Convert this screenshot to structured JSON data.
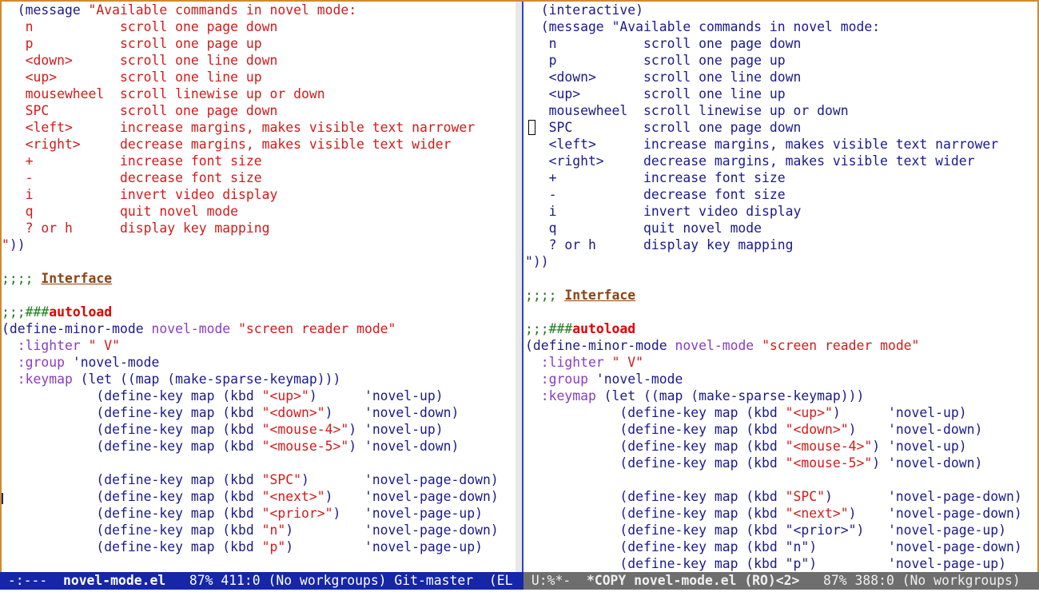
{
  "left_window": {
    "lines": [
      [
        {
          "t": "  (",
          "c": "t-kw"
        },
        {
          "t": "message",
          "c": "t-kw"
        },
        {
          "t": " \"Available commands in novel mode:",
          "c": "t-str"
        }
      ],
      [
        {
          "t": "   n           scroll one page down",
          "c": "t-str"
        }
      ],
      [
        {
          "t": "   p           scroll one page up",
          "c": "t-str"
        }
      ],
      [
        {
          "t": "   <down>      scroll one line down",
          "c": "t-str"
        }
      ],
      [
        {
          "t": "   <up>        scroll one line up",
          "c": "t-str"
        }
      ],
      [
        {
          "t": "   mousewheel  scroll linewise up or down",
          "c": "t-str"
        }
      ],
      [
        {
          "t": "   SPC         scroll one page down",
          "c": "t-str"
        }
      ],
      [
        {
          "t": "   <left>      increase margins, makes visible text narrower",
          "c": "t-str"
        }
      ],
      [
        {
          "t": "   <right>     decrease margins, makes visible text wider",
          "c": "t-str"
        }
      ],
      [
        {
          "t": "   +           increase font size",
          "c": "t-str"
        }
      ],
      [
        {
          "t": "   -           decrease font size",
          "c": "t-str"
        }
      ],
      [
        {
          "t": "   i           invert video display",
          "c": "t-str"
        }
      ],
      [
        {
          "t": "   q           quit novel mode",
          "c": "t-str"
        }
      ],
      [
        {
          "t": "   ? or h      display key mapping",
          "c": "t-str"
        }
      ],
      [
        {
          "t": "\"",
          "c": "t-str"
        },
        {
          "t": "))",
          "c": "t-kw"
        }
      ],
      [
        {
          "t": "",
          "c": "t-kw"
        }
      ],
      [
        {
          "t": ";;;; ",
          "c": "t-com"
        },
        {
          "t": "Interface",
          "c": "t-head"
        }
      ],
      [
        {
          "t": "",
          "c": "t-kw"
        }
      ],
      [
        {
          "t": ";;;###",
          "c": "t-com"
        },
        {
          "t": "autoload",
          "c": "t-cookie"
        }
      ],
      [
        {
          "t": "(define-minor-mode ",
          "c": "t-kw"
        },
        {
          "t": "novel-mode",
          "c": "t-fn"
        },
        {
          "t": " ",
          "c": "t-kw"
        },
        {
          "t": "\"screen reader mode\"",
          "c": "t-str"
        }
      ],
      [
        {
          "t": "  :lighter",
          "c": "t-fn"
        },
        {
          "t": " ",
          "c": "t-kw"
        },
        {
          "t": "\" V\"",
          "c": "t-str"
        }
      ],
      [
        {
          "t": "  :group",
          "c": "t-fn"
        },
        {
          "t": " 'novel-mode",
          "c": "t-kw"
        }
      ],
      [
        {
          "t": "  :keymap",
          "c": "t-fn"
        },
        {
          "t": " (let ((map (make-sparse-keymap)))",
          "c": "t-kw"
        }
      ],
      [
        {
          "t": "            (define-key map (kbd ",
          "c": "t-kw"
        },
        {
          "t": "\"<up>\"",
          "c": "t-str"
        },
        {
          "t": ")      'novel-up)",
          "c": "t-kw"
        }
      ],
      [
        {
          "t": "            (define-key map (kbd ",
          "c": "t-kw"
        },
        {
          "t": "\"<down>\"",
          "c": "t-str"
        },
        {
          "t": ")    'novel-down)",
          "c": "t-kw"
        }
      ],
      [
        {
          "t": "            (define-key map (kbd ",
          "c": "t-kw"
        },
        {
          "t": "\"<mouse-4>\"",
          "c": "t-str"
        },
        {
          "t": ") 'novel-up)",
          "c": "t-kw"
        }
      ],
      [
        {
          "t": "            (define-key map (kbd ",
          "c": "t-kw"
        },
        {
          "t": "\"<mouse-5>\"",
          "c": "t-str"
        },
        {
          "t": ") 'novel-down)",
          "c": "t-kw"
        }
      ],
      [
        {
          "t": "",
          "c": "t-kw"
        }
      ],
      [
        {
          "t": "            (define-key map (kbd ",
          "c": "t-kw"
        },
        {
          "t": "\"SPC\"",
          "c": "t-str"
        },
        {
          "t": ")       'novel-page-down)",
          "c": "t-kw"
        }
      ],
      [
        {
          "t": "            (define-key map (kbd ",
          "c": "t-kw"
        },
        {
          "t": "\"<next>\"",
          "c": "t-str"
        },
        {
          "t": ")    'novel-page-down)",
          "c": "t-kw"
        }
      ],
      [
        {
          "t": "            (define-key map (kbd ",
          "c": "t-kw"
        },
        {
          "t": "\"<prior>\"",
          "c": "t-str"
        },
        {
          "t": ")   'novel-page-up)",
          "c": "t-kw"
        }
      ],
      [
        {
          "t": "            (define-key map (kbd ",
          "c": "t-kw"
        },
        {
          "t": "\"n\"",
          "c": "t-str"
        },
        {
          "t": ")         'novel-page-down)",
          "c": "t-kw"
        }
      ],
      [
        {
          "t": "            (define-key map (kbd ",
          "c": "t-kw"
        },
        {
          "t": "\"p\"",
          "c": "t-str"
        },
        {
          "t": ")         'novel-page-up)",
          "c": "t-kw"
        }
      ]
    ]
  },
  "right_window": {
    "lines": [
      [
        {
          "t": "  (interactive)",
          "c": "t-kw"
        }
      ],
      [
        {
          "t": "  (message ",
          "c": "t-kw"
        },
        {
          "t": "\"Available commands in novel mode:",
          "c": "t-kw"
        }
      ],
      [
        {
          "t": "   n           scroll one page down",
          "c": "t-kw"
        }
      ],
      [
        {
          "t": "   p           scroll one page up",
          "c": "t-kw"
        }
      ],
      [
        {
          "t": "   <down>      scroll one line down",
          "c": "t-kw"
        }
      ],
      [
        {
          "t": "   <up>        scroll one line up",
          "c": "t-kw"
        }
      ],
      [
        {
          "t": "   mousewheel  scroll linewise up or down",
          "c": "t-kw"
        }
      ],
      [
        {
          "t": "   SPC         scroll one page down",
          "c": "t-kw"
        }
      ],
      [
        {
          "t": "   <left>      increase margins, makes visible text narrower",
          "c": "t-kw"
        }
      ],
      [
        {
          "t": "   <right>     decrease margins, makes visible text wider",
          "c": "t-kw"
        }
      ],
      [
        {
          "t": "   +           increase font size",
          "c": "t-kw"
        }
      ],
      [
        {
          "t": "   -           decrease font size",
          "c": "t-kw"
        }
      ],
      [
        {
          "t": "   i           invert video display",
          "c": "t-kw"
        }
      ],
      [
        {
          "t": "   q           quit novel mode",
          "c": "t-kw"
        }
      ],
      [
        {
          "t": "   ? or h      display key mapping",
          "c": "t-kw"
        }
      ],
      [
        {
          "t": "\"))",
          "c": "t-kw"
        }
      ],
      [
        {
          "t": "",
          "c": "t-kw"
        }
      ],
      [
        {
          "t": ";;;; ",
          "c": "t-com"
        },
        {
          "t": "Interface",
          "c": "t-head"
        }
      ],
      [
        {
          "t": "",
          "c": "t-kw"
        }
      ],
      [
        {
          "t": ";;;###",
          "c": "t-com"
        },
        {
          "t": "autoload",
          "c": "t-cookie"
        }
      ],
      [
        {
          "t": "(define-minor-mode ",
          "c": "t-kw"
        },
        {
          "t": "novel-mode",
          "c": "t-fn"
        },
        {
          "t": " ",
          "c": "t-kw"
        },
        {
          "t": "\"screen reader mode\"",
          "c": "t-str"
        }
      ],
      [
        {
          "t": "  :lighter",
          "c": "t-fn"
        },
        {
          "t": " ",
          "c": "t-kw"
        },
        {
          "t": "\" V\"",
          "c": "t-str"
        }
      ],
      [
        {
          "t": "  :group",
          "c": "t-fn"
        },
        {
          "t": " 'novel-mode",
          "c": "t-kw"
        }
      ],
      [
        {
          "t": "  :keymap",
          "c": "t-fn"
        },
        {
          "t": " (let ((map (make-sparse-keymap)))",
          "c": "t-kw"
        }
      ],
      [
        {
          "t": "            (define-key map (kbd ",
          "c": "t-kw"
        },
        {
          "t": "\"<up>\"",
          "c": "t-str"
        },
        {
          "t": ")      'novel-up)",
          "c": "t-kw"
        }
      ],
      [
        {
          "t": "            (define-key map (kbd ",
          "c": "t-kw"
        },
        {
          "t": "\"<down>\"",
          "c": "t-str"
        },
        {
          "t": ")    'novel-down)",
          "c": "t-kw"
        }
      ],
      [
        {
          "t": "            (define-key map (kbd ",
          "c": "t-kw"
        },
        {
          "t": "\"<mouse-4>\"",
          "c": "t-str"
        },
        {
          "t": ") 'novel-up)",
          "c": "t-kw"
        }
      ],
      [
        {
          "t": "            (define-key map (kbd ",
          "c": "t-kw"
        },
        {
          "t": "\"<mouse-5>\"",
          "c": "t-str"
        },
        {
          "t": ") 'novel-down)",
          "c": "t-kw"
        }
      ],
      [
        {
          "t": "",
          "c": "t-kw"
        }
      ],
      [
        {
          "t": "            (define-key map (kbd ",
          "c": "t-kw"
        },
        {
          "t": "\"SPC\"",
          "c": "t-str"
        },
        {
          "t": ")       'novel-page-down)",
          "c": "t-kw"
        }
      ],
      [
        {
          "t": "            (define-key map (kbd ",
          "c": "t-kw"
        },
        {
          "t": "\"<next>\"",
          "c": "t-str"
        },
        {
          "t": ")    'novel-page-down)",
          "c": "t-kw"
        }
      ],
      [
        {
          "t": "            (define-key map (kbd ",
          "c": "t-kw"
        },
        {
          "t": "\"<prior>\"",
          "c": "t-kw"
        },
        {
          "t": ")   'novel-page-up)",
          "c": "t-kw"
        }
      ],
      [
        {
          "t": "            (define-key map (kbd ",
          "c": "t-kw"
        },
        {
          "t": "\"n\"",
          "c": "t-kw"
        },
        {
          "t": ")         'novel-page-down)",
          "c": "t-kw"
        }
      ],
      [
        {
          "t": "            (define-key map (kbd ",
          "c": "t-kw"
        },
        {
          "t": "\"p\"",
          "c": "t-kw"
        },
        {
          "t": ")         'novel-page-up)",
          "c": "t-kw"
        }
      ]
    ]
  },
  "modeline_left": {
    "state": " -:---  ",
    "buffer_name": "novel-mode.el",
    "rest": "   87% 411:0 (No workgroups) Git-master  (EL"
  },
  "modeline_right": {
    "state": " U:%*-  ",
    "buffer_name": "*COPY novel-mode.el (RO)<2>",
    "rest": "   87% 388:0 (No workgroups)"
  },
  "colors": {
    "string": "#d41a1a",
    "keyword": "#1a1a8c",
    "builtin": "#8a3cc2",
    "comment": "#1e7a1e",
    "modeline_active": "#1526a8",
    "modeline_inactive": "#6e6e6e",
    "frame_border": "#d08b2c"
  }
}
